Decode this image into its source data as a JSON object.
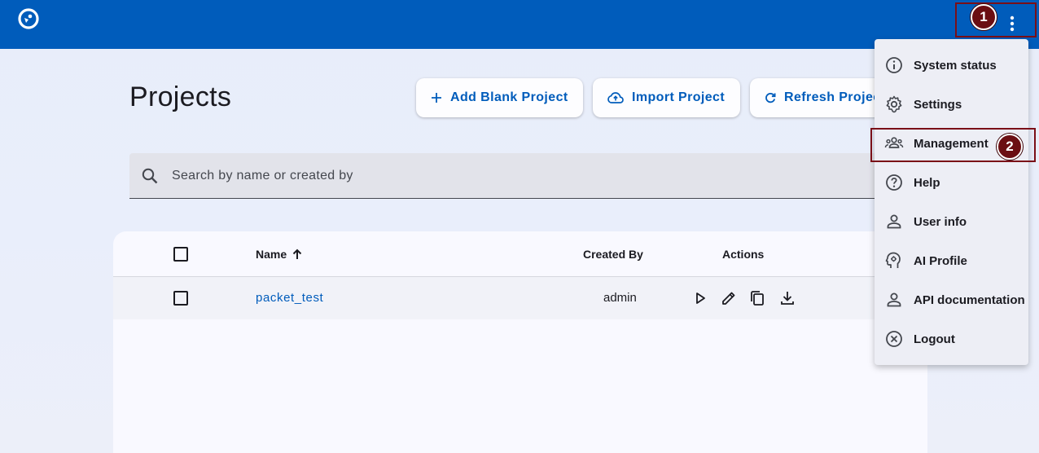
{
  "header": {
    "logo_icon": "app-logo-icon",
    "menu_icon": "more-vert-icon"
  },
  "annotations": {
    "step1": "1",
    "step2": "2"
  },
  "page": {
    "title": "Projects"
  },
  "toolbar": {
    "add_label": "Add Blank Project",
    "import_label": "Import Project",
    "refresh_label": "Refresh Projects"
  },
  "search": {
    "placeholder": "Search by name or created by"
  },
  "table": {
    "headers": {
      "name": "Name",
      "created_by": "Created By",
      "actions": "Actions"
    },
    "sort": "ascending",
    "rows": [
      {
        "name": "packet_test",
        "created_by": "admin"
      }
    ]
  },
  "menu": {
    "items": [
      {
        "label": "System status",
        "icon": "info-icon"
      },
      {
        "label": "Settings",
        "icon": "gear-icon"
      },
      {
        "label": "Management",
        "icon": "group-icon"
      },
      {
        "label": "Help",
        "icon": "help-icon"
      },
      {
        "label": "User info",
        "icon": "person-icon"
      },
      {
        "label": "AI Profile",
        "icon": "ai-profile-icon"
      },
      {
        "label": "API documentation",
        "icon": "person-icon"
      },
      {
        "label": "Logout",
        "icon": "close-circle-icon"
      }
    ]
  },
  "colors": {
    "primary": "#005cbb",
    "annotation": "#7a0f17"
  }
}
